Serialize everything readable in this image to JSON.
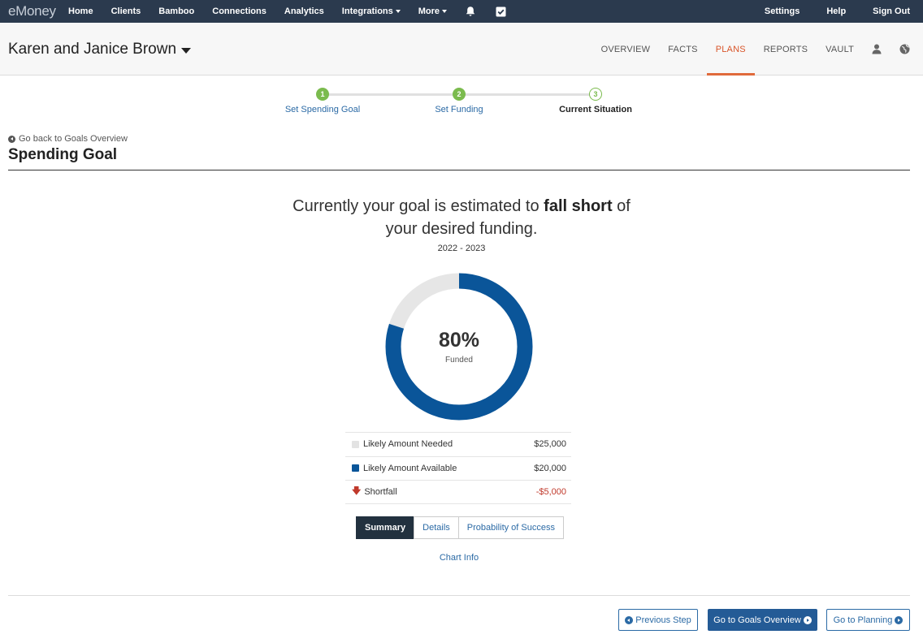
{
  "nav": {
    "logo": "eMoney",
    "left_items": [
      {
        "label": "Home",
        "caret": false
      },
      {
        "label": "Clients",
        "caret": false
      },
      {
        "label": "Bamboo",
        "caret": false
      },
      {
        "label": "Connections",
        "caret": false
      },
      {
        "label": "Analytics",
        "caret": false
      },
      {
        "label": "Integrations",
        "caret": true
      },
      {
        "label": "More",
        "caret": true
      }
    ],
    "icons": [
      "bell-icon",
      "checkbox-icon"
    ],
    "right_items": [
      "Settings",
      "Help",
      "Sign Out"
    ]
  },
  "client": {
    "name": "Karen and Janice Brown",
    "tabs": [
      "OVERVIEW",
      "FACTS",
      "PLANS",
      "REPORTS",
      "VAULT"
    ],
    "active_tab": "PLANS",
    "tab_icons": [
      "user-icon",
      "globe-icon"
    ]
  },
  "stepper": {
    "steps": [
      {
        "number": "1",
        "label": "Set Spending Goal",
        "state": "done"
      },
      {
        "number": "2",
        "label": "Set Funding",
        "state": "done"
      },
      {
        "number": "3",
        "label": "Current Situation",
        "state": "current"
      }
    ]
  },
  "page": {
    "back_link": "Go back to Goals Overview",
    "title": "Spending Goal",
    "headline_pre": "Currently your goal is estimated to ",
    "headline_bold": "fall short",
    "headline_post": " of",
    "headline_line2": "your desired funding.",
    "date_range": "2022 - 2023"
  },
  "donut": {
    "percent_label": "80%",
    "percent_value": 0.8,
    "sub_label": "Funded",
    "colors": {
      "funded": "#0a5599",
      "remaining": "#e6e6e6"
    }
  },
  "legend": [
    {
      "label": "Likely Amount Needed",
      "value": "$25,000",
      "marker": "swatch",
      "color": "#e3e3e3"
    },
    {
      "label": "Likely Amount Available",
      "value": "$20,000",
      "marker": "swatch",
      "color": "#0a5599"
    },
    {
      "label": "Shortfall",
      "value": "-$5,000",
      "marker": "down-arrow-icon",
      "color": "#c0392b"
    }
  ],
  "views": {
    "options": [
      "Summary",
      "Details",
      "Probability of Success"
    ],
    "active": "Summary"
  },
  "chart_info": "Chart Info",
  "footer": {
    "previous": "Previous Step",
    "goals_overview": "Go to Goals Overview",
    "planning": "Go to Planning"
  }
}
